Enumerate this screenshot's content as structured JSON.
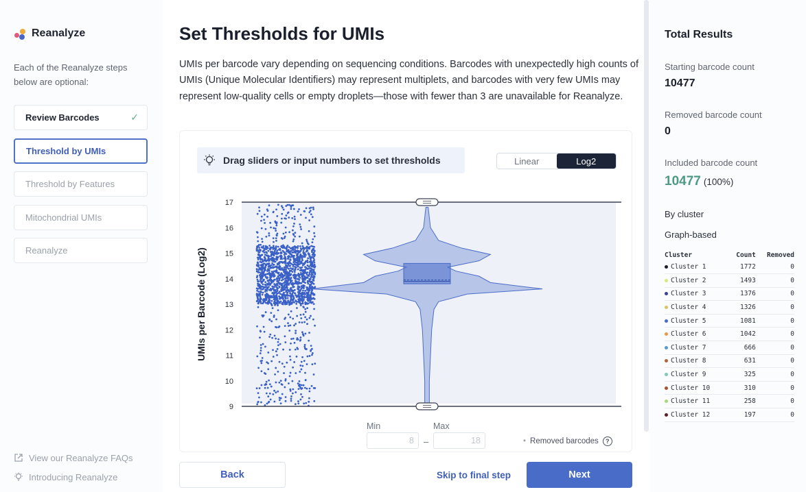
{
  "sidebar": {
    "brand": "Reanalyze",
    "description": "Each of the Reanalyze steps below are optional:",
    "steps": [
      {
        "label": "Review Barcodes",
        "state": "done"
      },
      {
        "label": "Threshold by UMIs",
        "state": "active"
      },
      {
        "label": "Threshold by Features",
        "state": "pending"
      },
      {
        "label": "Mitochondrial UMIs",
        "state": "pending"
      },
      {
        "label": "Reanalyze",
        "state": "pending"
      }
    ],
    "links": [
      {
        "label": "View our Reanalyze FAQs",
        "icon": "external-link-icon"
      },
      {
        "label": "Introducing Reanalyze",
        "icon": "lightbulb-icon"
      }
    ]
  },
  "main": {
    "title": "Set Thresholds for UMIs",
    "description": "UMIs per barcode vary depending on sequencing conditions. Barcodes with unexpectedly high counts of UMIs (Unique Molecular Identifiers) may represent multiplets, and barcodes with very few UMIs may represent low-quality cells or empty droplets—those with fewer than 3 are unavailable for Reanalyze.",
    "hint": "Drag sliders or input numbers to set thresholds",
    "scale_options": {
      "linear": "Linear",
      "log2": "Log2"
    },
    "scale_selected": "Log2",
    "min_label": "Min",
    "max_label": "Max",
    "min_value": "8",
    "max_value": "18",
    "removed_note": "Removed barcodes",
    "back": "Back",
    "skip": "Skip to final step",
    "next": "Next"
  },
  "chart_data": {
    "type": "violin",
    "ylabel": "UMIs per Barcode (Log2)",
    "ylim": [
      9,
      17
    ],
    "yticks": [
      "9",
      "10",
      "11",
      "12",
      "13",
      "14",
      "15",
      "16",
      "17"
    ],
    "threshold_min": 9,
    "threshold_max": 17,
    "box": {
      "q1": 13.8,
      "median": 13.9,
      "q3": 14.6,
      "mean": 13.95
    },
    "density_profile": [
      {
        "y": 9.0,
        "w": 0.02
      },
      {
        "y": 10.0,
        "w": 0.02
      },
      {
        "y": 11.0,
        "w": 0.03
      },
      {
        "y": 12.0,
        "w": 0.04
      },
      {
        "y": 12.8,
        "w": 0.06
      },
      {
        "y": 13.1,
        "w": 0.1
      },
      {
        "y": 13.4,
        "w": 0.35
      },
      {
        "y": 13.6,
        "w": 1.0
      },
      {
        "y": 13.85,
        "w": 0.55
      },
      {
        "y": 14.1,
        "w": 0.45
      },
      {
        "y": 14.3,
        "w": 0.25
      },
      {
        "y": 14.45,
        "w": 0.18
      },
      {
        "y": 14.7,
        "w": 0.45
      },
      {
        "y": 14.95,
        "w": 0.55
      },
      {
        "y": 15.2,
        "w": 0.3
      },
      {
        "y": 15.5,
        "w": 0.1
      },
      {
        "y": 16.0,
        "w": 0.03
      },
      {
        "y": 16.8,
        "w": 0.01
      }
    ],
    "colors": {
      "violin": "#4a6cc9",
      "points": "#3a60c6",
      "area": "#eef1f8"
    }
  },
  "results": {
    "title": "Total Results",
    "starting_label": "Starting barcode count",
    "starting_value": "10477",
    "removed_label": "Removed barcode count",
    "removed_value": "0",
    "included_label": "Included barcode count",
    "included_value": "10477",
    "included_pct": "(100%)",
    "by_cluster": "By cluster",
    "graph_based": "Graph-based",
    "table_headers": {
      "cluster": "Cluster",
      "count": "Count",
      "removed": "Removed"
    },
    "clusters": [
      {
        "name": "Cluster 1",
        "count": "1772",
        "removed": "0",
        "color": "#1a1f2b"
      },
      {
        "name": "Cluster 2",
        "count": "1493",
        "removed": "0",
        "color": "#d8e87a"
      },
      {
        "name": "Cluster 3",
        "count": "1376",
        "removed": "0",
        "color": "#3a3f9a"
      },
      {
        "name": "Cluster 4",
        "count": "1326",
        "removed": "0",
        "color": "#d9c46a"
      },
      {
        "name": "Cluster 5",
        "count": "1081",
        "removed": "0",
        "color": "#4a6cc9"
      },
      {
        "name": "Cluster 6",
        "count": "1042",
        "removed": "0",
        "color": "#e79a4a"
      },
      {
        "name": "Cluster 7",
        "count": "666",
        "removed": "0",
        "color": "#5a9ad0"
      },
      {
        "name": "Cluster 8",
        "count": "631",
        "removed": "0",
        "color": "#b5643a"
      },
      {
        "name": "Cluster 9",
        "count": "325",
        "removed": "0",
        "color": "#7fc9b0"
      },
      {
        "name": "Cluster 10",
        "count": "310",
        "removed": "0",
        "color": "#a8532e"
      },
      {
        "name": "Cluster 11",
        "count": "258",
        "removed": "0",
        "color": "#a6d97a"
      },
      {
        "name": "Cluster 12",
        "count": "197",
        "removed": "0",
        "color": "#5a1f2a"
      }
    ]
  }
}
